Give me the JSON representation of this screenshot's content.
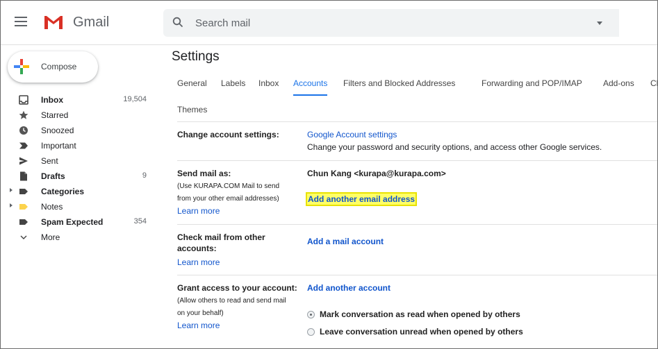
{
  "header": {
    "brand": "Gmail",
    "search_placeholder": "Search mail"
  },
  "compose": {
    "label": "Compose"
  },
  "sidebar": {
    "items": [
      {
        "label": "Inbox",
        "count": "19,504",
        "bold": true,
        "icon": "inbox-icon"
      },
      {
        "label": "Starred",
        "count": "",
        "bold": false,
        "icon": "star-icon"
      },
      {
        "label": "Snoozed",
        "count": "",
        "bold": false,
        "icon": "clock-icon"
      },
      {
        "label": "Important",
        "count": "",
        "bold": false,
        "icon": "important-icon"
      },
      {
        "label": "Sent",
        "count": "",
        "bold": false,
        "icon": "send-icon"
      },
      {
        "label": "Drafts",
        "count": "9",
        "bold": true,
        "icon": "draft-icon"
      },
      {
        "label": "Categories",
        "count": "",
        "bold": true,
        "icon": "label-icon"
      },
      {
        "label": "Notes",
        "count": "",
        "bold": false,
        "icon": "label-yellow-icon"
      },
      {
        "label": "Spam Expected",
        "count": "354",
        "bold": true,
        "icon": "label-icon"
      },
      {
        "label": "More",
        "count": "",
        "bold": false,
        "icon": "chevron-down-icon"
      }
    ]
  },
  "settings": {
    "title": "Settings",
    "tabs": [
      "General",
      "Labels",
      "Inbox",
      "Accounts",
      "Filters and Blocked Addresses",
      "Forwarding and POP/IMAP",
      "Add-ons",
      "Cl"
    ],
    "active_tab": "Accounts",
    "tabs_row2": "Themes",
    "sections": {
      "change": {
        "label": "Change account settings:",
        "link": "Google Account settings",
        "desc": "Change your password and security options, and access other Google services."
      },
      "send": {
        "label": "Send mail as:",
        "sub1": "(Use KURAPA.COM Mail to send",
        "sub2": "from your other email addresses)",
        "learn": "Learn more",
        "address": "Chun Kang <kurapa@kurapa.com>",
        "add_link": "Add another email address"
      },
      "check": {
        "label1": "Check mail from other",
        "label2": "accounts:",
        "learn": "Learn more",
        "add_link": "Add a mail account"
      },
      "grant": {
        "label": "Grant access to your account:",
        "sub1": "(Allow others to read and send mail",
        "sub2": "on your behalf)",
        "learn": "Learn more",
        "add_link": "Add another account",
        "option_read": "Mark conversation as read when opened by others",
        "option_unread": "Leave conversation unread when opened by others"
      }
    }
  },
  "colors": {
    "accent": "#1a73e8",
    "link": "#1155cc",
    "highlight": "#ffff66"
  }
}
